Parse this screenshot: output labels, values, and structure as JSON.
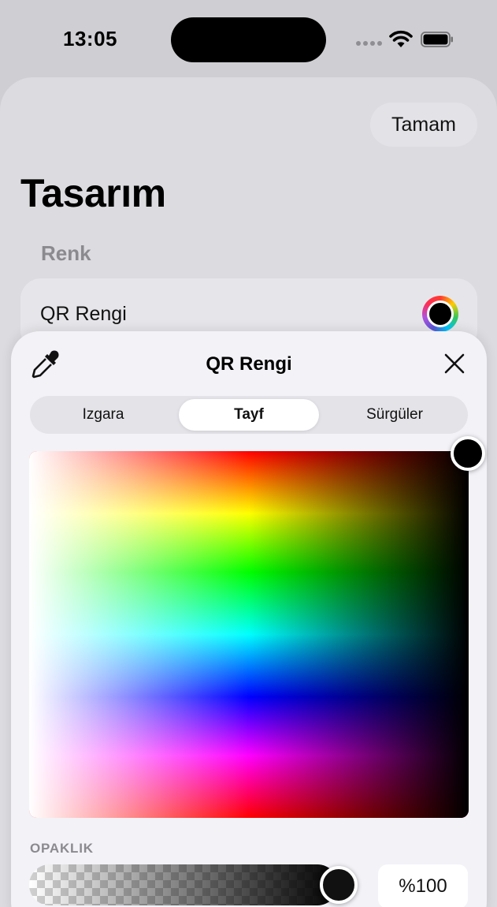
{
  "status_bar": {
    "time": "13:05"
  },
  "header": {
    "done_label": "Tamam",
    "title": "Tasarım"
  },
  "section": {
    "label": "Renk",
    "row_label": "QR Rengi",
    "selected_color": "#000000"
  },
  "picker": {
    "title": "QR Rengi",
    "tabs": [
      {
        "label": "Izgara",
        "selected": false
      },
      {
        "label": "Tayf",
        "selected": true
      },
      {
        "label": "Sürgüler",
        "selected": false
      }
    ],
    "opacity_label": "OPAKLIK",
    "opacity_value": "%100",
    "opacity_fraction": 1.0
  },
  "icons": [
    "signal-icon",
    "wifi-icon",
    "battery-icon",
    "eyedropper-icon",
    "close-icon"
  ]
}
